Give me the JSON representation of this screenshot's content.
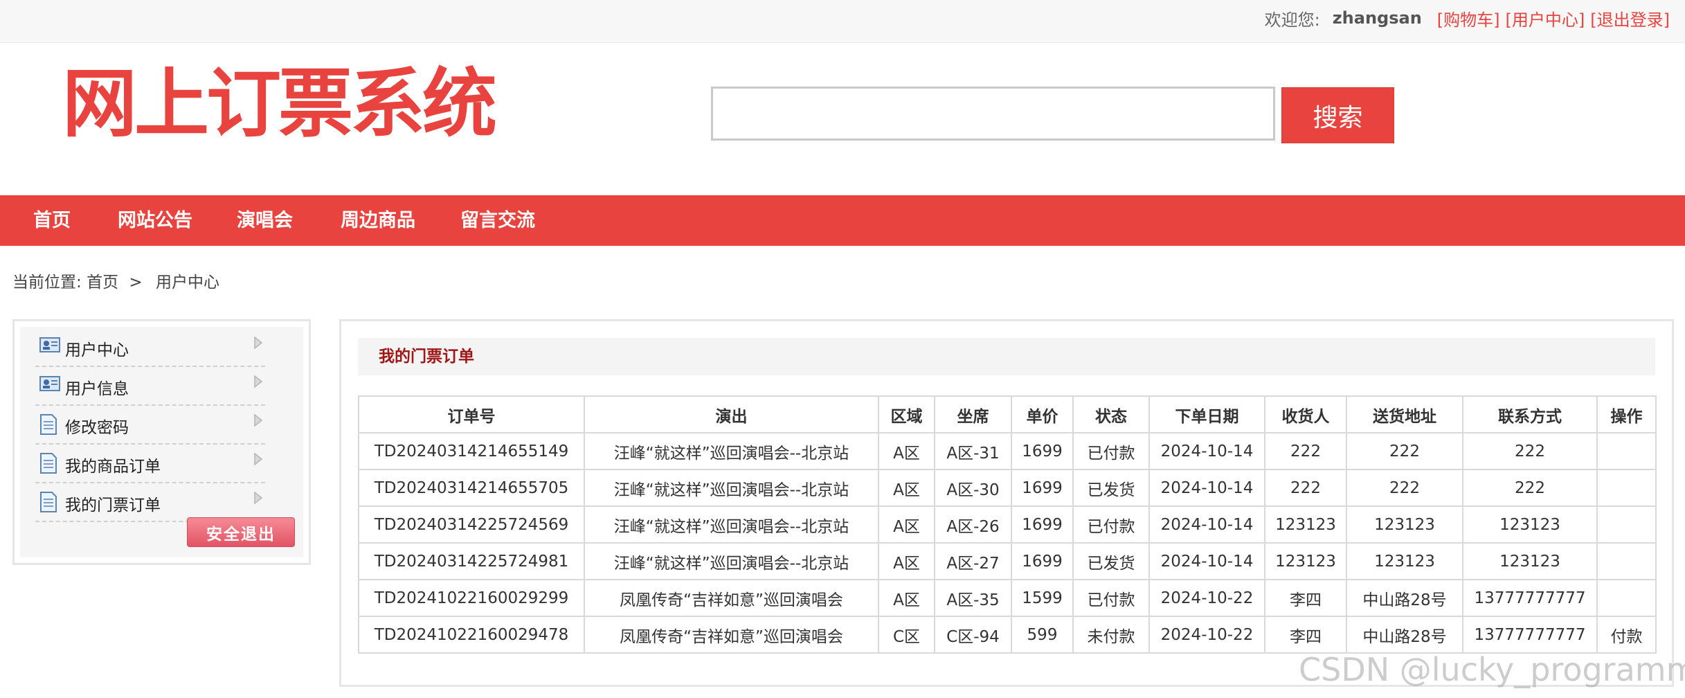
{
  "topbar": {
    "welcome": "欢迎您:",
    "username": "zhangsan",
    "links": [
      "[购物车]",
      "[用户中心]",
      "[退出登录]"
    ]
  },
  "logo": {
    "text": "网上订票系统"
  },
  "search": {
    "value": "",
    "placeholder": "",
    "button": "搜索"
  },
  "nav": {
    "items": [
      "首页",
      "网站公告",
      "演唱会",
      "周边商品",
      "留言交流"
    ]
  },
  "breadcrumb": {
    "prefix": "当前位置:",
    "home": "首页",
    "separator": ">",
    "current": "用户中心"
  },
  "sidebar": {
    "items": [
      {
        "label": "用户中心",
        "icon": "user-card-icon"
      },
      {
        "label": "用户信息",
        "icon": "user-card-icon"
      },
      {
        "label": "修改密码",
        "icon": "document-icon"
      },
      {
        "label": "我的商品订单",
        "icon": "document-icon"
      },
      {
        "label": "我的门票订单",
        "icon": "document-icon"
      }
    ],
    "logout_label": "安全退出"
  },
  "panel": {
    "title": "我的门票订单"
  },
  "table": {
    "headers": [
      "订单号",
      "演出",
      "区域",
      "坐席",
      "单价",
      "状态",
      "下单日期",
      "收货人",
      "送货地址",
      "联系方式",
      "操作"
    ],
    "rows": [
      [
        "TD20240314214655149",
        "汪峰“就这样”巡回演唱会--北京站",
        "A区",
        "A区-31",
        "1699",
        "已付款",
        "2024-10-14",
        "222",
        "222",
        "222",
        ""
      ],
      [
        "TD20240314214655705",
        "汪峰“就这样”巡回演唱会--北京站",
        "A区",
        "A区-30",
        "1699",
        "已发货",
        "2024-10-14",
        "222",
        "222",
        "222",
        ""
      ],
      [
        "TD20240314225724569",
        "汪峰“就这样”巡回演唱会--北京站",
        "A区",
        "A区-26",
        "1699",
        "已付款",
        "2024-10-14",
        "123123",
        "123123",
        "123123",
        ""
      ],
      [
        "TD20240314225724981",
        "汪峰“就这样”巡回演唱会--北京站",
        "A区",
        "A区-27",
        "1699",
        "已发货",
        "2024-10-14",
        "123123",
        "123123",
        "123123",
        ""
      ],
      [
        "TD20241022160029299",
        "凤凰传奇“吉祥如意”巡回演唱会",
        "A区",
        "A区-35",
        "1599",
        "已付款",
        "2024-10-22",
        "李四",
        "中山路28号",
        "13777777777",
        ""
      ],
      [
        "TD20241022160029478",
        "凤凰传奇“吉祥如意”巡回演唱会",
        "C区",
        "C区-94",
        "599",
        "未付款",
        "2024-10-22",
        "李四",
        "中山路28号",
        "13777777777",
        "付款"
      ]
    ]
  },
  "watermark": "CSDN @lucky_programmer",
  "colors": {
    "accent": "#e8433f",
    "title_red": "#a01515"
  }
}
